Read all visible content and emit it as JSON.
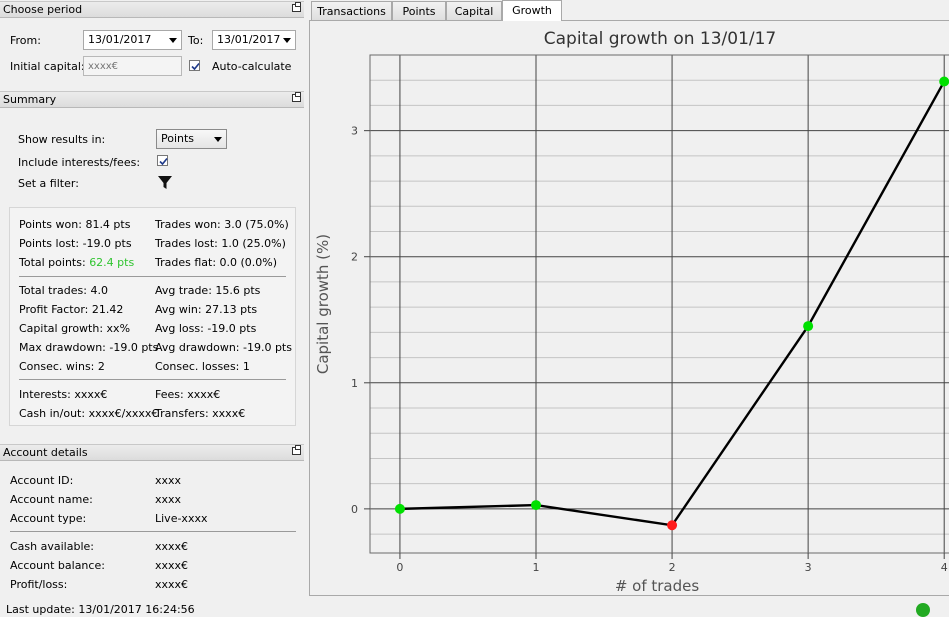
{
  "choose_period": {
    "header": "Choose period",
    "from_label": "From:",
    "from_value": "13/01/2017",
    "to_label": "To:",
    "to_value": "13/01/2017",
    "initial_capital_label": "Initial capital:",
    "initial_capital_placeholder": "xxxx€",
    "auto_calc_label": "Auto-calculate",
    "auto_calc_checked": true
  },
  "summary": {
    "header": "Summary",
    "show_results_label": "Show results in:",
    "show_results_value": "Points",
    "include_interests_label": "Include interests/fees:",
    "include_interests_checked": true,
    "filter_label": "Set a filter:",
    "points_won": "Points won: 81.4 pts",
    "trades_won": "Trades won: 3.0 (75.0%)",
    "points_lost": "Points lost: -19.0 pts",
    "trades_lost": "Trades lost: 1.0 (25.0%)",
    "total_points_label": "Total points: ",
    "total_points_value": "62.4 pts",
    "trades_flat": "Trades flat: 0.0 (0.0%)",
    "total_trades": "Total trades: 4.0",
    "avg_trade": "Avg trade: 15.6 pts",
    "profit_factor": "Profit Factor: 21.42",
    "avg_win": "Avg win: 27.13 pts",
    "capital_growth": "Capital growth: xx%",
    "avg_loss": "Avg loss: -19.0 pts",
    "max_drawdown": "Max drawdown: -19.0 pts",
    "avg_drawdown": "Avg drawdown: -19.0 pts",
    "consec_wins": "Consec. wins: 2",
    "consec_losses": "Consec. losses: 1",
    "interests": "Interests: xxxx€",
    "fees": "Fees: xxxx€",
    "cash_in_out": "Cash in/out: xxxx€/xxxx€",
    "transfers": "Transfers: xxxx€",
    "positive_color": "#2fc42f"
  },
  "account_details": {
    "header": "Account details",
    "account_id_label": "Account ID:",
    "account_id_value": "xxxx",
    "account_name_label": "Account name:",
    "account_name_value": "xxxx",
    "account_type_label": "Account type:",
    "account_type_value": "Live-xxxx",
    "cash_available_label": "Cash available:",
    "cash_available_value": "xxxx€",
    "account_balance_label": "Account balance:",
    "account_balance_value": "xxxx€",
    "profit_loss_label": "Profit/loss:",
    "profit_loss_value": "xxxx€"
  },
  "status_bar": {
    "last_update": "Last update: 13/01/2017 16:24:56",
    "status_color": "#22aa22"
  },
  "tabs": [
    {
      "label": "Transactions",
      "active": false
    },
    {
      "label": "Points",
      "active": false
    },
    {
      "label": "Capital",
      "active": false
    },
    {
      "label": "Growth",
      "active": true
    }
  ],
  "chart_data": {
    "type": "line",
    "title": "Capital growth on 13/01/17",
    "xlabel": "# of trades",
    "ylabel": "Capital growth (%)",
    "x": [
      0,
      1,
      2,
      3,
      4
    ],
    "y": [
      0.0,
      0.03,
      -0.13,
      1.45,
      3.39
    ],
    "point_colors": [
      "#00e000",
      "#00e000",
      "#ff1a1a",
      "#00e000",
      "#00e000"
    ],
    "x_ticks": [
      "0",
      "1",
      "2",
      "3",
      "4"
    ],
    "y_ticks": [
      "0",
      "1",
      "2",
      "3"
    ],
    "xlim": [
      -0.22,
      4.05
    ],
    "ylim": [
      -0.35,
      3.6
    ],
    "grid": true,
    "line_color": "#000000"
  }
}
